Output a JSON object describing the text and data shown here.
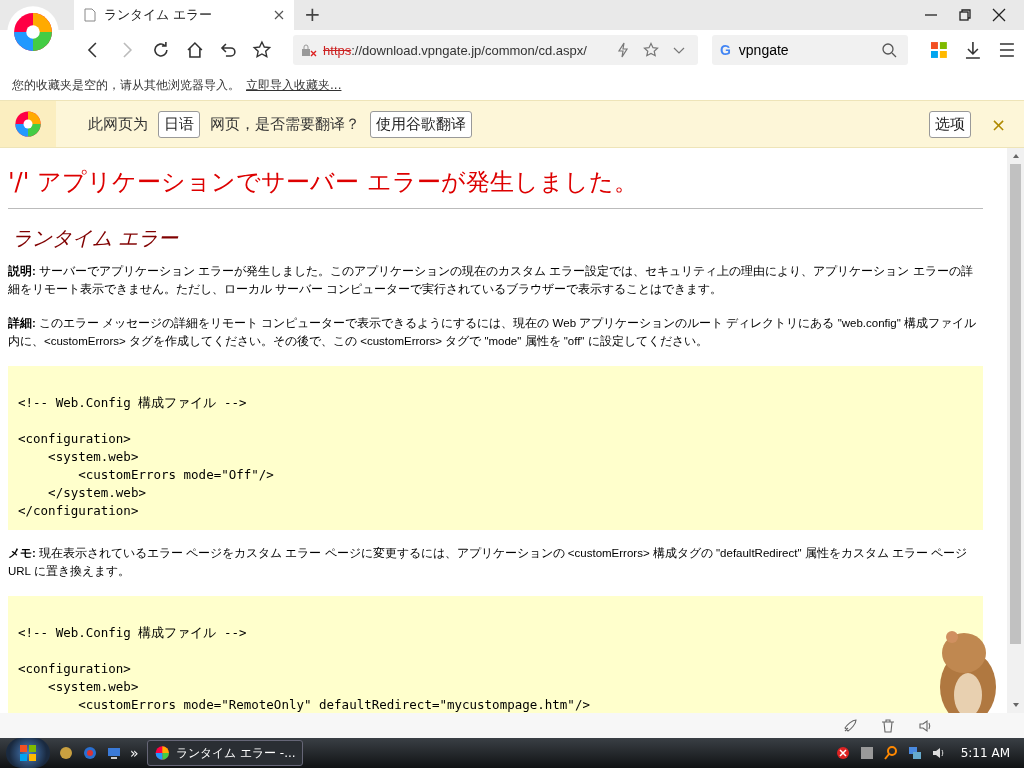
{
  "tabs": [
    {
      "title": "ランタイム エラー",
      "selected": true
    }
  ],
  "new_tab": "+",
  "address": {
    "scheme": "https",
    "rest": "://download.vpngate.jp/common/cd.aspx/",
    "insecure": true
  },
  "search": {
    "engine": "G",
    "value": "vpngate"
  },
  "bookmarks_bar": {
    "message": "您的收藏夹是空的，请从其他浏览器导入。",
    "link": "立即导入收藏夹..."
  },
  "translate_bar": {
    "prefix": "此网页为",
    "language": "日语",
    "suffix": "网页，是否需要翻译？",
    "translate_button": "使用谷歌翻译",
    "options_button": "选项",
    "close": "×"
  },
  "page": {
    "heading": "'/' アプリケーションでサーバー エラーが発生しました。",
    "subheading": "ランタイム エラー",
    "sections": [
      {
        "kind": "text",
        "text": "**説明:** サーバーでアプリケーション エラーが発生しました。このアプリケーションの現在のカスタム エラー設定では、セキュリティ上の理由により、アプリケーション エラーの詳細をリモート表示できません。ただし、ローカル サーバー コンピューターで実行されているブラウザーで表示することはできます。"
      },
      {
        "kind": "text",
        "text": "**詳細:** このエラー メッセージの詳細をリモート コンピューターで表示できるようにするには、現在の Web アプリケーションのルート ディレクトリにある \"web.config\" 構成ファイル内に、<customErrors> タグを作成してください。その後で、この <customErrors> タグで \"mode\" 属性を \"off\" に設定してください。"
      },
      {
        "kind": "code",
        "comment": "<!-- Web.Config 構成ファイル -->",
        "lines": [
          "<configuration>",
          "    <system.web>",
          "        <customErrors mode=\"Off\"/>",
          "    </system.web>",
          "</configuration>"
        ]
      },
      {
        "kind": "text",
        "text": "**メモ:** 現在表示されているエラー ページをカスタム エラー ページに変更するには、アプリケーションの <customErrors> 構成タグの \"defaultRedirect\" 属性をカスタム エラー ページ URL に置き換えます。"
      },
      {
        "kind": "code",
        "comment": "<!-- Web.Config 構成ファイル -->",
        "lines": [
          "<configuration>",
          "    <system.web>",
          "        <customErrors mode=\"RemoteOnly\" defaultRedirect=\"mycustompage.htm\"/>"
        ]
      }
    ]
  },
  "taskbar": {
    "window": "ランタイム エラー -...",
    "more": "»",
    "clock": "5:11 AM"
  }
}
